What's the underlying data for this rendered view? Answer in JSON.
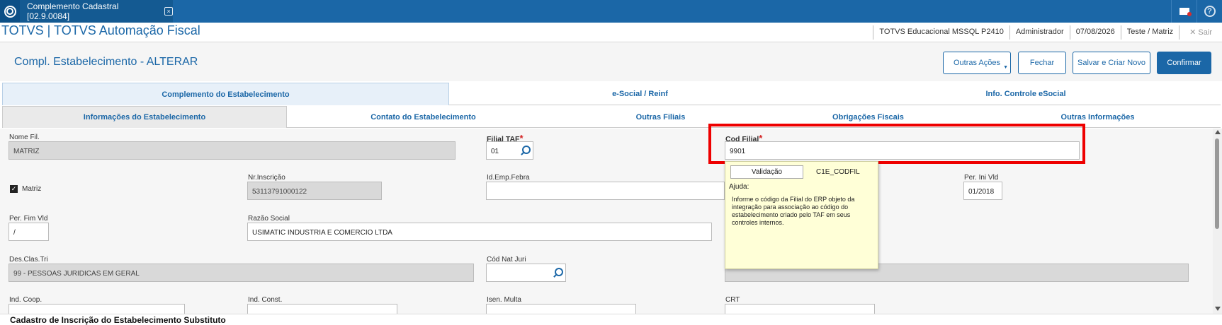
{
  "window": {
    "tab_title": "Complemento Cadastral [02.9.0084]",
    "tab_close": "×"
  },
  "appbar": {
    "title": "TOTVS | TOTVS Automação Fiscal",
    "environment": "TOTVS Educacional MSSQL P2410",
    "user": "Administrador",
    "date": "07/08/2026",
    "branch": "Teste / Matriz",
    "exit_label": "✕ Sair"
  },
  "header": {
    "title": "Compl. Estabelecimento - ALTERAR",
    "buttons": {
      "outras_acoes": "Outras Ações",
      "fechar": "Fechar",
      "salvar_criar": "Salvar e Criar Novo",
      "confirmar": "Confirmar"
    }
  },
  "tabs_level1": [
    "Complemento do Estabelecimento",
    "e-Social / Reinf",
    "Info. Controle eSocial"
  ],
  "tabs_level2": [
    "Informações do Estabelecimento",
    "Contato do Estabelecimento",
    "Outras Filiais",
    "Obrigações Fiscais",
    "Outras Informações"
  ],
  "form": {
    "nome_fil": {
      "label": "Nome Fil.",
      "value": "MATRIZ"
    },
    "filial_taf": {
      "label": "Filial TAF",
      "value": "01",
      "required_mark": "*"
    },
    "cod_filial": {
      "label": "Cod Filial",
      "value": "9901",
      "required_mark": "*"
    },
    "matriz": {
      "label": "Matriz",
      "checked": true,
      "check_glyph": "✓"
    },
    "nr_inscricao": {
      "label": "Nr.Inscrição",
      "value": "53113791000122"
    },
    "id_emp_febra": {
      "label": "Id.Emp.Febra",
      "value": ""
    },
    "per_ini_vld": {
      "label": "Per. Ini Vld",
      "value": "01/2018"
    },
    "per_fim_vld": {
      "label": "Per. Fim Vld",
      "value": "/"
    },
    "razao_social": {
      "label": "Razão Social",
      "value": "USIMATIC INDUSTRIA E COMERCIO LTDA"
    },
    "des_clas_tri": {
      "label": "Des.Clas.Tri",
      "value": "99 - PESSOAS JURIDICAS EM GERAL"
    },
    "cod_nat_juri": {
      "label": "Cód Nat Juri",
      "value": ""
    },
    "ind_coop": {
      "label": "Ind. Coop."
    },
    "ind_const": {
      "label": "Ind. Const."
    },
    "isen_multa": {
      "label": "Isen. Multa"
    },
    "crt": {
      "label": "CRT"
    }
  },
  "tooltip": {
    "button": "Validação",
    "field_name": "C1E_CODFIL",
    "help_label": "Ajuda:",
    "help_text": "Informe o código da Filial do ERP objeto da integração para associação ao código do estabelecimento criado pelo TAF em seus controles internos."
  },
  "footer": {
    "title": "Cadastro de Inscrição do Estabelecimento Substituto"
  },
  "colors": {
    "brand_blue": "#1b67a7",
    "highlight_red": "#e00000",
    "tooltip_bg": "#ffffd7"
  }
}
